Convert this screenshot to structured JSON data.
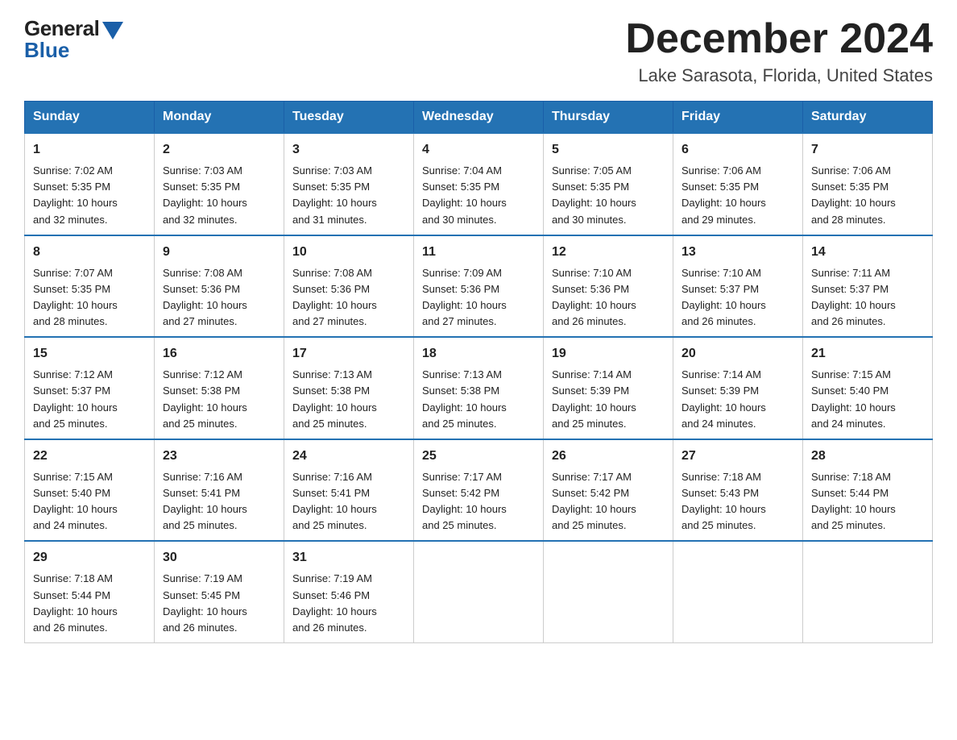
{
  "logo": {
    "general": "General",
    "blue": "Blue"
  },
  "header": {
    "month": "December 2024",
    "location": "Lake Sarasota, Florida, United States"
  },
  "days_of_week": [
    "Sunday",
    "Monday",
    "Tuesday",
    "Wednesday",
    "Thursday",
    "Friday",
    "Saturday"
  ],
  "weeks": [
    [
      {
        "day": "1",
        "sunrise": "7:02 AM",
        "sunset": "5:35 PM",
        "daylight": "10 hours and 32 minutes."
      },
      {
        "day": "2",
        "sunrise": "7:03 AM",
        "sunset": "5:35 PM",
        "daylight": "10 hours and 32 minutes."
      },
      {
        "day": "3",
        "sunrise": "7:03 AM",
        "sunset": "5:35 PM",
        "daylight": "10 hours and 31 minutes."
      },
      {
        "day": "4",
        "sunrise": "7:04 AM",
        "sunset": "5:35 PM",
        "daylight": "10 hours and 30 minutes."
      },
      {
        "day": "5",
        "sunrise": "7:05 AM",
        "sunset": "5:35 PM",
        "daylight": "10 hours and 30 minutes."
      },
      {
        "day": "6",
        "sunrise": "7:06 AM",
        "sunset": "5:35 PM",
        "daylight": "10 hours and 29 minutes."
      },
      {
        "day": "7",
        "sunrise": "7:06 AM",
        "sunset": "5:35 PM",
        "daylight": "10 hours and 28 minutes."
      }
    ],
    [
      {
        "day": "8",
        "sunrise": "7:07 AM",
        "sunset": "5:35 PM",
        "daylight": "10 hours and 28 minutes."
      },
      {
        "day": "9",
        "sunrise": "7:08 AM",
        "sunset": "5:36 PM",
        "daylight": "10 hours and 27 minutes."
      },
      {
        "day": "10",
        "sunrise": "7:08 AM",
        "sunset": "5:36 PM",
        "daylight": "10 hours and 27 minutes."
      },
      {
        "day": "11",
        "sunrise": "7:09 AM",
        "sunset": "5:36 PM",
        "daylight": "10 hours and 27 minutes."
      },
      {
        "day": "12",
        "sunrise": "7:10 AM",
        "sunset": "5:36 PM",
        "daylight": "10 hours and 26 minutes."
      },
      {
        "day": "13",
        "sunrise": "7:10 AM",
        "sunset": "5:37 PM",
        "daylight": "10 hours and 26 minutes."
      },
      {
        "day": "14",
        "sunrise": "7:11 AM",
        "sunset": "5:37 PM",
        "daylight": "10 hours and 26 minutes."
      }
    ],
    [
      {
        "day": "15",
        "sunrise": "7:12 AM",
        "sunset": "5:37 PM",
        "daylight": "10 hours and 25 minutes."
      },
      {
        "day": "16",
        "sunrise": "7:12 AM",
        "sunset": "5:38 PM",
        "daylight": "10 hours and 25 minutes."
      },
      {
        "day": "17",
        "sunrise": "7:13 AM",
        "sunset": "5:38 PM",
        "daylight": "10 hours and 25 minutes."
      },
      {
        "day": "18",
        "sunrise": "7:13 AM",
        "sunset": "5:38 PM",
        "daylight": "10 hours and 25 minutes."
      },
      {
        "day": "19",
        "sunrise": "7:14 AM",
        "sunset": "5:39 PM",
        "daylight": "10 hours and 25 minutes."
      },
      {
        "day": "20",
        "sunrise": "7:14 AM",
        "sunset": "5:39 PM",
        "daylight": "10 hours and 24 minutes."
      },
      {
        "day": "21",
        "sunrise": "7:15 AM",
        "sunset": "5:40 PM",
        "daylight": "10 hours and 24 minutes."
      }
    ],
    [
      {
        "day": "22",
        "sunrise": "7:15 AM",
        "sunset": "5:40 PM",
        "daylight": "10 hours and 24 minutes."
      },
      {
        "day": "23",
        "sunrise": "7:16 AM",
        "sunset": "5:41 PM",
        "daylight": "10 hours and 25 minutes."
      },
      {
        "day": "24",
        "sunrise": "7:16 AM",
        "sunset": "5:41 PM",
        "daylight": "10 hours and 25 minutes."
      },
      {
        "day": "25",
        "sunrise": "7:17 AM",
        "sunset": "5:42 PM",
        "daylight": "10 hours and 25 minutes."
      },
      {
        "day": "26",
        "sunrise": "7:17 AM",
        "sunset": "5:42 PM",
        "daylight": "10 hours and 25 minutes."
      },
      {
        "day": "27",
        "sunrise": "7:18 AM",
        "sunset": "5:43 PM",
        "daylight": "10 hours and 25 minutes."
      },
      {
        "day": "28",
        "sunrise": "7:18 AM",
        "sunset": "5:44 PM",
        "daylight": "10 hours and 25 minutes."
      }
    ],
    [
      {
        "day": "29",
        "sunrise": "7:18 AM",
        "sunset": "5:44 PM",
        "daylight": "10 hours and 26 minutes."
      },
      {
        "day": "30",
        "sunrise": "7:19 AM",
        "sunset": "5:45 PM",
        "daylight": "10 hours and 26 minutes."
      },
      {
        "day": "31",
        "sunrise": "7:19 AM",
        "sunset": "5:46 PM",
        "daylight": "10 hours and 26 minutes."
      },
      null,
      null,
      null,
      null
    ]
  ],
  "labels": {
    "sunrise": "Sunrise:",
    "sunset": "Sunset:",
    "daylight": "Daylight:"
  }
}
